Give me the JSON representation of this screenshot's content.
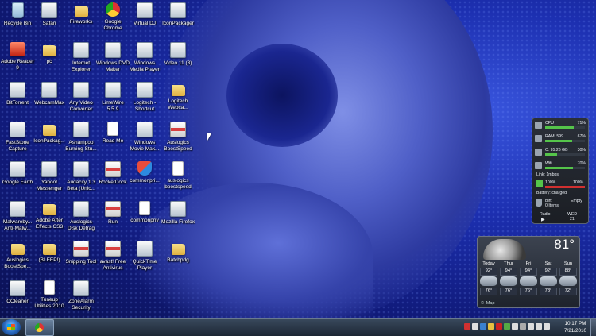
{
  "desktop_icons": [
    {
      "label": "Recycle Bin",
      "icon": "recycle-bin-icon"
    },
    {
      "label": "Safari",
      "icon": "app-icon"
    },
    {
      "label": "Fireworks",
      "icon": "folder-icon"
    },
    {
      "label": "Google Chrome",
      "icon": "chrome-icon"
    },
    {
      "label": "Virtual DJ",
      "icon": "app-icon"
    },
    {
      "label": "IconPackager",
      "icon": "app-icon"
    },
    {
      "label": "Adobe Reader 9",
      "icon": "red-app-icon"
    },
    {
      "label": "pc",
      "icon": "folder-icon"
    },
    {
      "label": "Internet Explorer",
      "icon": "app-icon"
    },
    {
      "label": "Windows DVD Maker",
      "icon": "app-icon"
    },
    {
      "label": "Windows Media Player",
      "icon": "app-icon"
    },
    {
      "label": "Video 11 (3)",
      "icon": "app-icon"
    },
    {
      "label": "BitTorrent",
      "icon": "app-icon"
    },
    {
      "label": "WebcamMax",
      "icon": "app-icon"
    },
    {
      "label": "Any Video Converter",
      "icon": "app-icon"
    },
    {
      "label": "LimeWire 5.5.9",
      "icon": "app-icon"
    },
    {
      "label": "Logitech - Shortcut",
      "icon": "app-icon"
    },
    {
      "label": "Logitech Webca...",
      "icon": "folder-icon"
    },
    {
      "label": "FastStone Capture",
      "icon": "app-icon"
    },
    {
      "label": "IconPackag...",
      "icon": "folder-icon"
    },
    {
      "label": "Ashampoo Burning Stu...",
      "icon": "app-icon"
    },
    {
      "label": "Read Me",
      "icon": "document-icon"
    },
    {
      "label": "Windows Movie Mak...",
      "icon": "app-icon"
    },
    {
      "label": "Auslogics BoostSpeed",
      "icon": "package-icon"
    },
    {
      "label": "Google Earth",
      "icon": "app-icon"
    },
    {
      "label": "Yahoo! Messenger",
      "icon": "app-icon"
    },
    {
      "label": "Audacity 1.3 Beta (Unic...",
      "icon": "app-icon"
    },
    {
      "label": "RocketDock",
      "icon": "package-icon"
    },
    {
      "label": "commonpri...",
      "icon": "shield-icon"
    },
    {
      "label": "auslogics boostspeed",
      "icon": "document-icon"
    },
    {
      "label": "Malwareby... Anti-Malw...",
      "icon": "app-icon"
    },
    {
      "label": "Adobe After Effects CS3",
      "icon": "folder-icon"
    },
    {
      "label": "Auslogics Disk Defrag",
      "icon": "app-icon"
    },
    {
      "label": "Run",
      "icon": "package-icon"
    },
    {
      "label": "commonpriv",
      "icon": "document-icon"
    },
    {
      "label": "Mozilla Firefox",
      "icon": "app-icon"
    },
    {
      "label": "Auslogics BoostSpe...",
      "icon": "folder-icon"
    },
    {
      "label": "(BLEEP!)",
      "icon": "folder-icon"
    },
    {
      "label": "Snipping Tool",
      "icon": "package-icon"
    },
    {
      "label": "avast! Free Antivirus",
      "icon": "package-icon"
    },
    {
      "label": "QuickTime Player",
      "icon": "app-icon"
    },
    {
      "label": "Batchpdg",
      "icon": "folder-icon"
    },
    {
      "label": "CCleaner",
      "icon": "app-icon"
    },
    {
      "label": "Tuneup Utilities 2010",
      "icon": "document-icon"
    },
    {
      "label": "ZoneAlarm Security",
      "icon": "app-icon"
    }
  ],
  "meter": {
    "rows": [
      {
        "name": "CPU",
        "value": "71%",
        "level": 0.71
      },
      {
        "name": "RAM: 599",
        "value": "67%",
        "level": 0.67
      },
      {
        "name": "C:  95.26 GB",
        "value": "30%",
        "level": 0.3
      },
      {
        "name": "Wifi",
        "value": "70%",
        "level": 0.7
      }
    ],
    "link": "Link: 1mbps",
    "battery_left": "100%",
    "battery_right": "100%",
    "battery_status": "Battery: charged",
    "bin_label": "Bin:",
    "bin_items": "0 Items",
    "empty_label": "Empty",
    "radio_label": "Radio",
    "day_label": "WED",
    "date_num": "21"
  },
  "weather": {
    "temp": "81°",
    "days": [
      {
        "name": "Today",
        "hi": "92°",
        "lo": "76°"
      },
      {
        "name": "Thur",
        "hi": "94°",
        "lo": "76°"
      },
      {
        "name": "Fri",
        "hi": "94°",
        "lo": "76°"
      },
      {
        "name": "Sat",
        "hi": "92°",
        "lo": "73°"
      },
      {
        "name": "Sun",
        "hi": "88°",
        "lo": "72°"
      }
    ],
    "source": "© iMap"
  },
  "taskbar": {
    "time": "10:17 PM",
    "date": "7/21/2010",
    "tray_colors": [
      "#d03030",
      "#e0e0e0",
      "#3a80d0",
      "#e8c040",
      "#cc2222",
      "#55aa44",
      "#dddddd",
      "#aaaaaa",
      "#dddddd",
      "#dddddd",
      "#dddddd"
    ]
  }
}
